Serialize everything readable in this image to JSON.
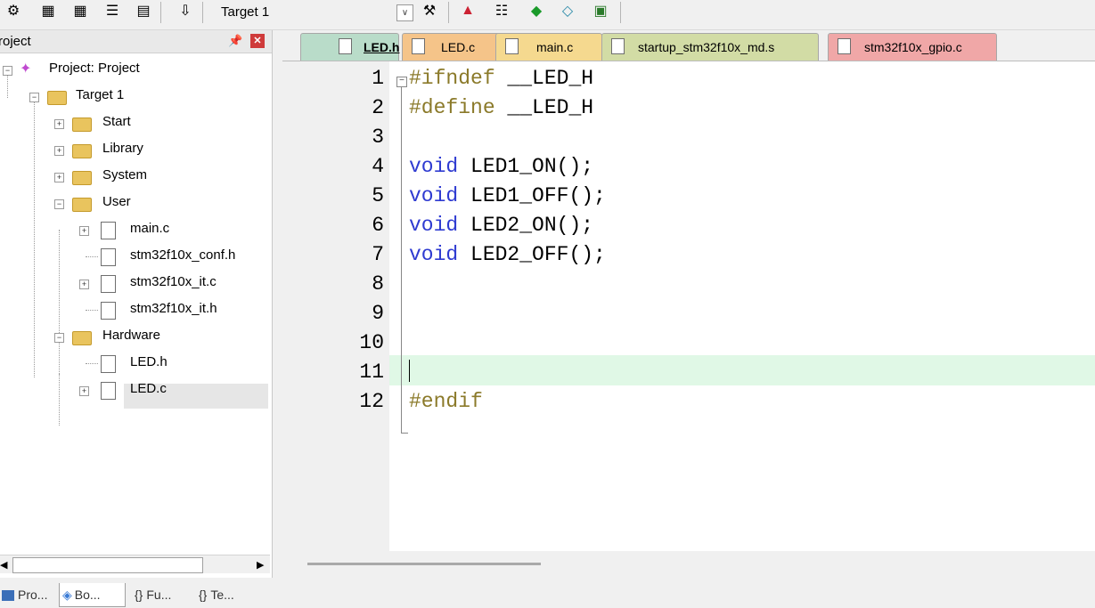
{
  "toolbar": {
    "target_value": "Target 1",
    "icons": [
      "batch-build-icon",
      "rebuild-icon",
      "build-icon",
      "stack-icon",
      "download-icon",
      "load-icon",
      "options-icon",
      "manage-icon",
      "pack-installer-icon",
      "select-device-icon",
      "inspect-icon"
    ]
  },
  "project_panel": {
    "title": "roject",
    "tree": {
      "project_label": "Project: Project",
      "target_label": "Target 1",
      "groups": [
        "Start",
        "Library",
        "System",
        "User",
        "Hardware"
      ],
      "user_files": [
        "main.c",
        "stm32f10x_conf.h",
        "stm32f10x_it.c",
        "stm32f10x_it.h"
      ],
      "hardware_files": [
        "LED.h",
        "LED.c"
      ]
    },
    "bottom_tabs": [
      "Pro...",
      "Bo...",
      "Fu...",
      "Te..."
    ]
  },
  "editor": {
    "tabs": [
      {
        "label": "LED.h",
        "color": "#b9dcc9"
      },
      {
        "label": "LED.c",
        "color": "#f5c489"
      },
      {
        "label": "main.c",
        "color": "#f5d98f"
      },
      {
        "label": "startup_stm32f10x_md.s",
        "color": "#d2dca5"
      },
      {
        "label": "stm32f10x_gpio.c",
        "color": "#f0a7a7"
      }
    ],
    "line_numbers": [
      "1",
      "2",
      "3",
      "4",
      "5",
      "6",
      "7",
      "8",
      "9",
      "10",
      "11",
      "12"
    ],
    "lines": [
      {
        "pp": "#ifndef",
        "rest": " __LED_H"
      },
      {
        "pp": "#define",
        "rest": " __LED_H"
      },
      {
        "pp": "",
        "rest": ""
      },
      {
        "kw": "void",
        "rest": " LED1_ON();"
      },
      {
        "kw": "void",
        "rest": " LED1_OFF();"
      },
      {
        "kw": "void",
        "rest": " LED2_ON();"
      },
      {
        "kw": "void",
        "rest": " LED2_OFF();"
      },
      {
        "pp": "",
        "rest": ""
      },
      {
        "pp": "",
        "rest": ""
      },
      {
        "pp": "",
        "rest": ""
      },
      {
        "pp": "#endif",
        "rest": ""
      },
      {
        "pp": "",
        "rest": ""
      }
    ]
  }
}
